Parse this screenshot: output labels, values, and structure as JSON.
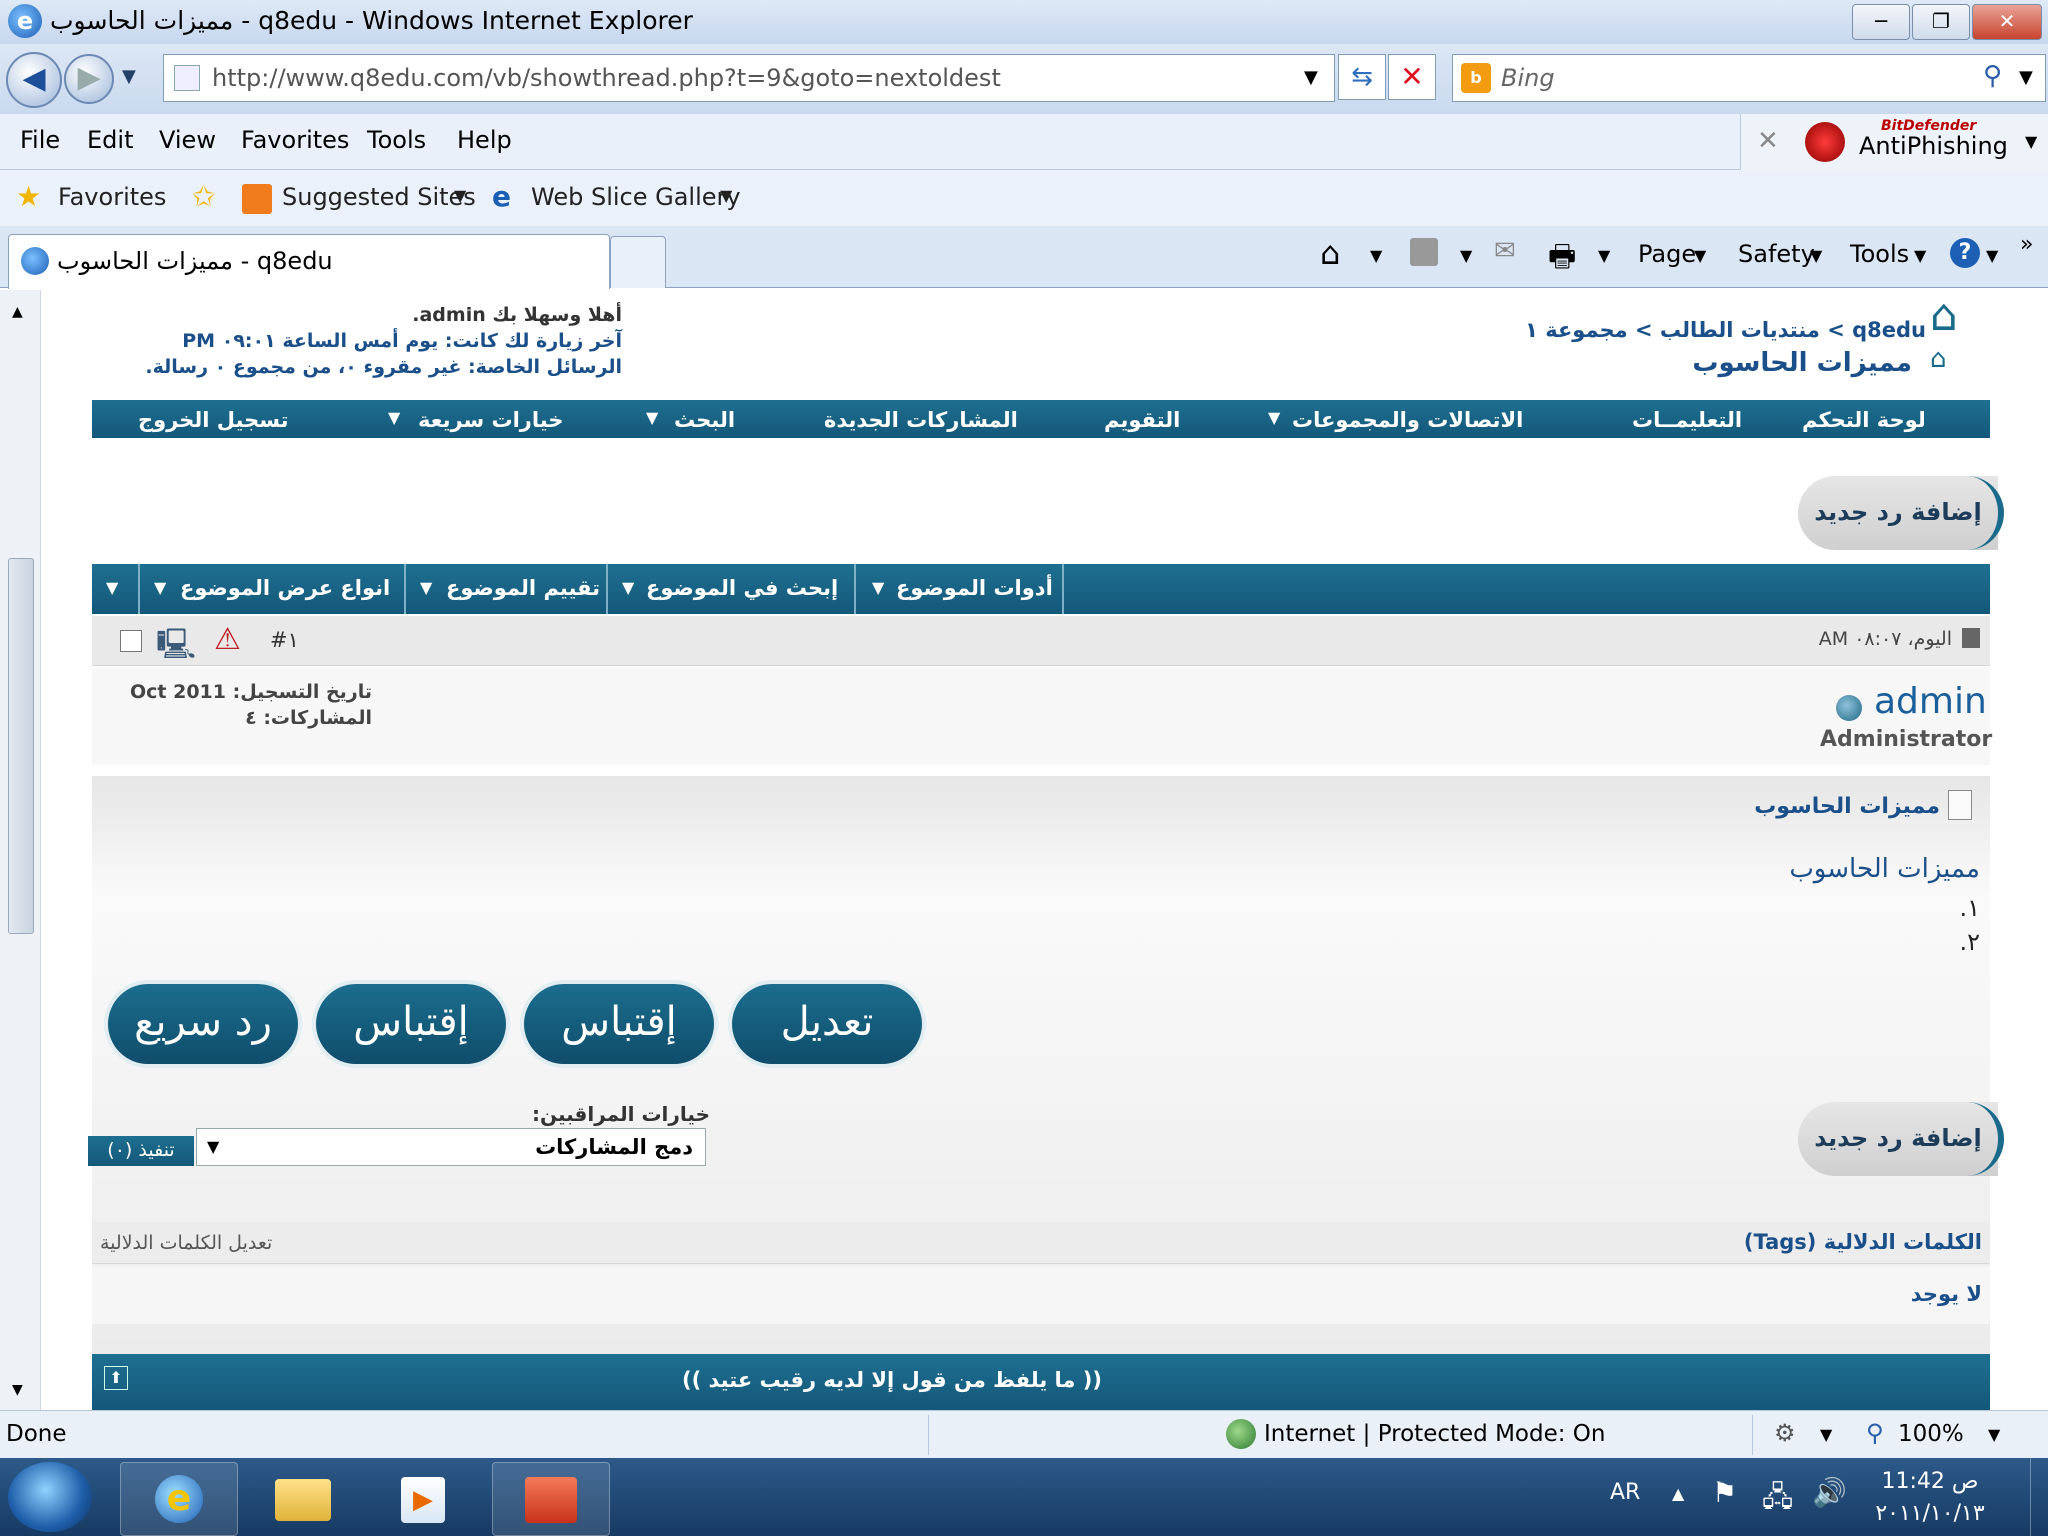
{
  "window": {
    "title": "مميزات الحاسوب - q8edu - Windows Internet Explorer"
  },
  "address": {
    "url": "http://www.q8edu.com/vb/showthread.php?t=9&goto=nextoldest",
    "search_placeholder": "Bing"
  },
  "menu": [
    "File",
    "Edit",
    "View",
    "Favorites",
    "Tools",
    "Help"
  ],
  "antiphishing": {
    "brand": "BitDefender",
    "label": "AntiPhishing"
  },
  "favorites": {
    "label": "Favorites",
    "suggested": "Suggested Sites",
    "webslice": "Web Slice Gallery"
  },
  "tab": {
    "title": "مميزات الحاسوب - q8edu"
  },
  "commands": {
    "page": "Page",
    "safety": "Safety",
    "tools": "Tools"
  },
  "header": {
    "welcome": "أهلا وسهلا بك admin.",
    "last_visit": "آخر زيارة لك كانت: يوم أمس الساعة ٠٩:٠١ PM",
    "private_messages": "الرسائل الخاصة: غير مقروء ٠، من مجموع ٠ رسالة.",
    "breadcrumb": "q8edu > منتديات الطالب > مجموعة ١",
    "thread_title": "مميزات الحاسوب"
  },
  "navbar": [
    "لوحة التحكم",
    "التعليمــات",
    "الاتصالات والمجموعات",
    "التقويم",
    "المشاركات الجديدة",
    "البحث",
    "خيارات سريعة",
    "تسجيل الخروج"
  ],
  "new_reply": "إضافة رد جديد",
  "thread_tools": [
    "أدوات الموضوع",
    "إبحث في الموضوع",
    "تقييم الموضوع",
    "انواع عرض الموضوع"
  ],
  "post": {
    "date": "اليوم، ٠٨:٠٧ AM",
    "number": "#١",
    "username": "admin",
    "usertitle": "Administrator",
    "join_date": "تاريخ التسجيل: Oct 2011",
    "posts": "المشاركات: ٤",
    "title": "مميزات الحاسوب",
    "body_heading": "مميزات الحاسوب",
    "list": [
      "١.",
      "٢."
    ],
    "buttons": {
      "edit": "تعديل",
      "quote": "إقتباس",
      "multiquote": "إقتباس",
      "quickreply": "رد سريع"
    }
  },
  "moderation": {
    "label": "خيارات المراقبين:",
    "selected": "دمج المشاركات",
    "go": "(٠) تنفيذ"
  },
  "tags": {
    "header": "الكلمات الدلالية (Tags)",
    "edit": "تعديل الكلمات الدلالية",
    "none": "لا يوجد"
  },
  "footer_quote": "(( ما يلفظ من قول إلا لديه رقيب عتيد ))",
  "status": {
    "left": "Done",
    "zone": "Internet | Protected Mode: On",
    "zoom": "100%"
  },
  "taskbar": {
    "lang": "AR",
    "time": "11:42 ص",
    "date": "٢٠١١/١٠/١٣"
  },
  "colors": {
    "accent": "#176486",
    "link": "#1a4f8a"
  }
}
